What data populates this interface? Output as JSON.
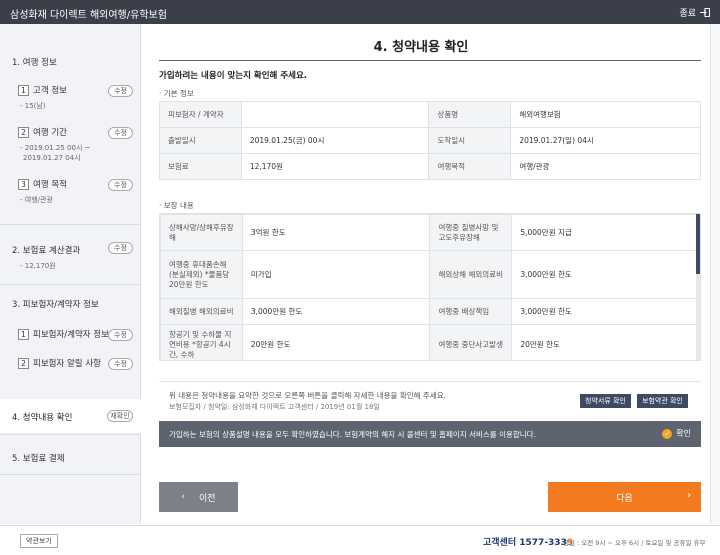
{
  "titlebar": {
    "title": "삼성화재 다이렉트 해외여행/유학보험",
    "close_label": "종료"
  },
  "sidebar": {
    "section1_title": "1. 여행 정보",
    "step1_label": "고객 정보",
    "step1_value": "- 15(남)",
    "step2_label": "여행 기간",
    "step2_line1": "- 2019.01.25 00시 ~",
    "step2_line2": "2019.01.27 04시",
    "step3_label": "여행 목적",
    "step3_value": "- 여행/관광",
    "section2_title": "2. 보험료 계산결과",
    "section2_value": "- 12,170원",
    "section3_title": "3. 피보험자/계약자 정보",
    "step31_label": "피보험자/계약자 정보",
    "step32_label": "피보험자 알릴 사항",
    "section4_title": "4. 청약내용 확인",
    "section4_badge": "재확인",
    "section5_title": "5. 보험료 결제",
    "edit_label": "수정"
  },
  "main": {
    "page_title": "4. 청약내용 확인",
    "confirm_question": "가입하려는 내용이 맞는지 확인해 주세요.",
    "basic_info_label": "기본 정보",
    "basic_info": [
      {
        "k1": "피보험자 / 계약자",
        "v1": "",
        "k2": "상품명",
        "v2": "해외여행보험"
      },
      {
        "k1": "출발일시",
        "v1": "2019.01.25(금) 00시",
        "k2": "도착일시",
        "v2": "2019.01.27(일) 04시"
      },
      {
        "k1": "보험료",
        "v1": "12,170원",
        "k2": "여행목적",
        "v2": "여행/관광"
      }
    ],
    "coverage_label": "보장 내용",
    "coverage": [
      {
        "k1": "상해사망/상해후유장해",
        "v1": "3억원 한도",
        "k2": "여행중 질병사망 및 고도후유장해",
        "v2": "5,000만원 지급"
      },
      {
        "k1": "여행중 휴대품손해 (분실제외) *물품당 20만원 한도",
        "v1": "미가입",
        "k2": "해외상해 해외의료비",
        "v2": "3,000만원 한도"
      },
      {
        "k1": "해외질병 해외의료비",
        "v1": "3,000만원 한도",
        "k2": "여행중 배상책임",
        "v2": "3,000만원 한도"
      },
      {
        "k1": "항공기 및 수하물 지연비용 *항공기 4시간, 수하",
        "v1": "20만원 한도",
        "k2": "여행중 중단사고발생",
        "v2": "20만원 한도"
      }
    ],
    "notice_line1": "위 내용은 청약내용을 요약한 것으로 오른쪽 버튼을 클릭해 자세한 내용을 확인해 주세요.",
    "notice_line2": "보험모집자 / 청약일: 삼성화재 다이렉트 고객센터 / 2019년 01월 18일",
    "btn_application_docs": "청약서류 확인",
    "btn_policy_terms": "보험약관 확인",
    "agree_text": "가입하는 보험의 상품설명 내용을 모두 확인하였습니다. 보험계약의 해지 시 콜센터 및 홈페이지 서비스를 이용합니다.",
    "agree_check_label": "확인",
    "prev_label": "이전",
    "next_label": "다음"
  },
  "footer": {
    "terms_label": "약관보기",
    "cc_label": "고객센터",
    "cc_number": "1577-333",
    "cc_number_last": "9",
    "hours": "평일 : 오전 9시 ~ 오후 6시 / 토요일 및 공휴일 휴무"
  },
  "colors": {
    "titlebar": "#3a3f4a",
    "accent": "#f47a20",
    "navy": "#3c4a63",
    "agree_bar": "#5d6470"
  }
}
